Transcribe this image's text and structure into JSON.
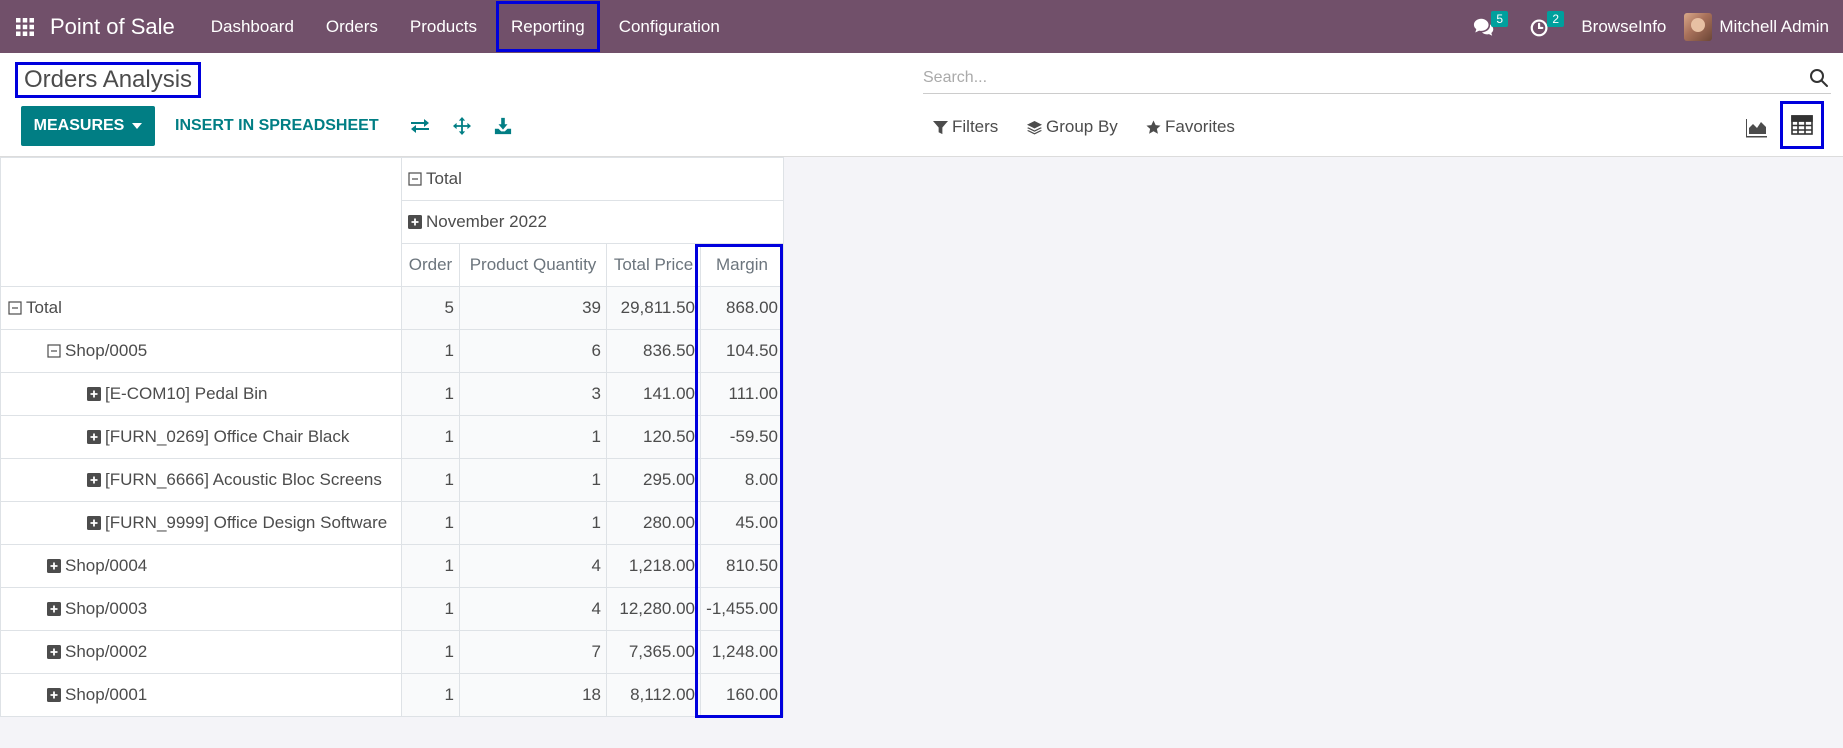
{
  "navbar": {
    "app_name": "Point of Sale",
    "menu": [
      "Dashboard",
      "Orders",
      "Products",
      "Reporting",
      "Configuration"
    ],
    "messages_count": "5",
    "activities_count": "2",
    "company": "BrowseInfo",
    "user": "Mitchell Admin"
  },
  "control_panel": {
    "title": "Orders Analysis",
    "search_placeholder": "Search...",
    "measures_label": "MEASURES",
    "insert_label": "INSERT IN SPREADSHEET",
    "filters_label": "Filters",
    "groupby_label": "Group By",
    "favorites_label": "Favorites"
  },
  "pivot": {
    "col_total": "Total",
    "col_group": "November 2022",
    "measures": [
      "Order",
      "Product Quantity",
      "Total Price",
      "Margin"
    ],
    "rows": [
      {
        "label": "Total",
        "order": "5",
        "qty": "39",
        "price": "29,811.50",
        "margin": "868.00"
      },
      {
        "label": "Shop/0005",
        "order": "1",
        "qty": "6",
        "price": "836.50",
        "margin": "104.50"
      },
      {
        "label": "[E-COM10] Pedal Bin",
        "order": "1",
        "qty": "3",
        "price": "141.00",
        "margin": "111.00"
      },
      {
        "label": "[FURN_0269] Office Chair Black",
        "order": "1",
        "qty": "1",
        "price": "120.50",
        "margin": "-59.50"
      },
      {
        "label": "[FURN_6666] Acoustic Bloc Screens",
        "order": "1",
        "qty": "1",
        "price": "295.00",
        "margin": "8.00"
      },
      {
        "label": "[FURN_9999] Office Design Software",
        "order": "1",
        "qty": "1",
        "price": "280.00",
        "margin": "45.00"
      },
      {
        "label": "Shop/0004",
        "order": "1",
        "qty": "4",
        "price": "1,218.00",
        "margin": "810.50"
      },
      {
        "label": "Shop/0003",
        "order": "1",
        "qty": "4",
        "price": "12,280.00",
        "margin": "-1,455.00"
      },
      {
        "label": "Shop/0002",
        "order": "1",
        "qty": "7",
        "price": "7,365.00",
        "margin": "1,248.00"
      },
      {
        "label": "Shop/0001",
        "order": "1",
        "qty": "18",
        "price": "8,112.00",
        "margin": "160.00"
      }
    ]
  }
}
